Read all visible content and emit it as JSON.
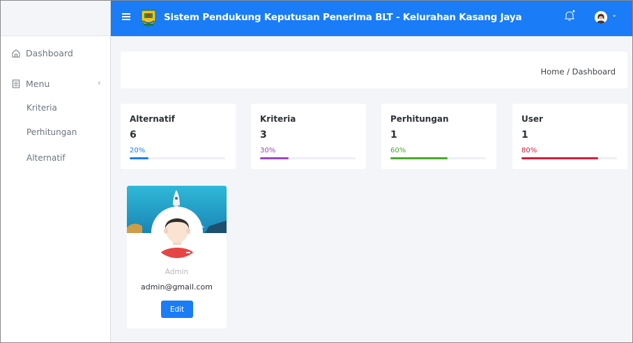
{
  "header": {
    "title": "Sistem Pendukung Keputusan Penerima BLT - Kelurahan Kasang Jaya",
    "logo_icon": "crest-logo",
    "bell_icon": "bell-icon",
    "user_icon": "user-avatar-icon"
  },
  "sidebar": {
    "dashboard_label": "Dashboard",
    "menu_label": "Menu",
    "sub_items": [
      {
        "label": "Kriteria"
      },
      {
        "label": "Perhitungan"
      },
      {
        "label": "Alternatif"
      }
    ]
  },
  "breadcrumb": {
    "text": "Home / Dashboard"
  },
  "stats": [
    {
      "label": "Alternatif",
      "value": "6",
      "percent_label": "20%",
      "progress": 0.2,
      "color": "#1a7cf6"
    },
    {
      "label": "Kriteria",
      "value": "3",
      "percent_label": "30%",
      "progress": 0.3,
      "color": "#9b45c9"
    },
    {
      "label": "Perhitungan",
      "value": "1",
      "percent_label": "60%",
      "progress": 0.6,
      "color": "#4aa82c"
    },
    {
      "label": "User",
      "value": "1",
      "percent_label": "80%",
      "progress": 0.8,
      "color": "#d81a3c"
    }
  ],
  "profile": {
    "name": "Admin",
    "email": "admin@gmail.com",
    "edit_label": "Edit"
  },
  "colors": {
    "primary": "#1a7cf6",
    "background": "#f3f5f9"
  }
}
